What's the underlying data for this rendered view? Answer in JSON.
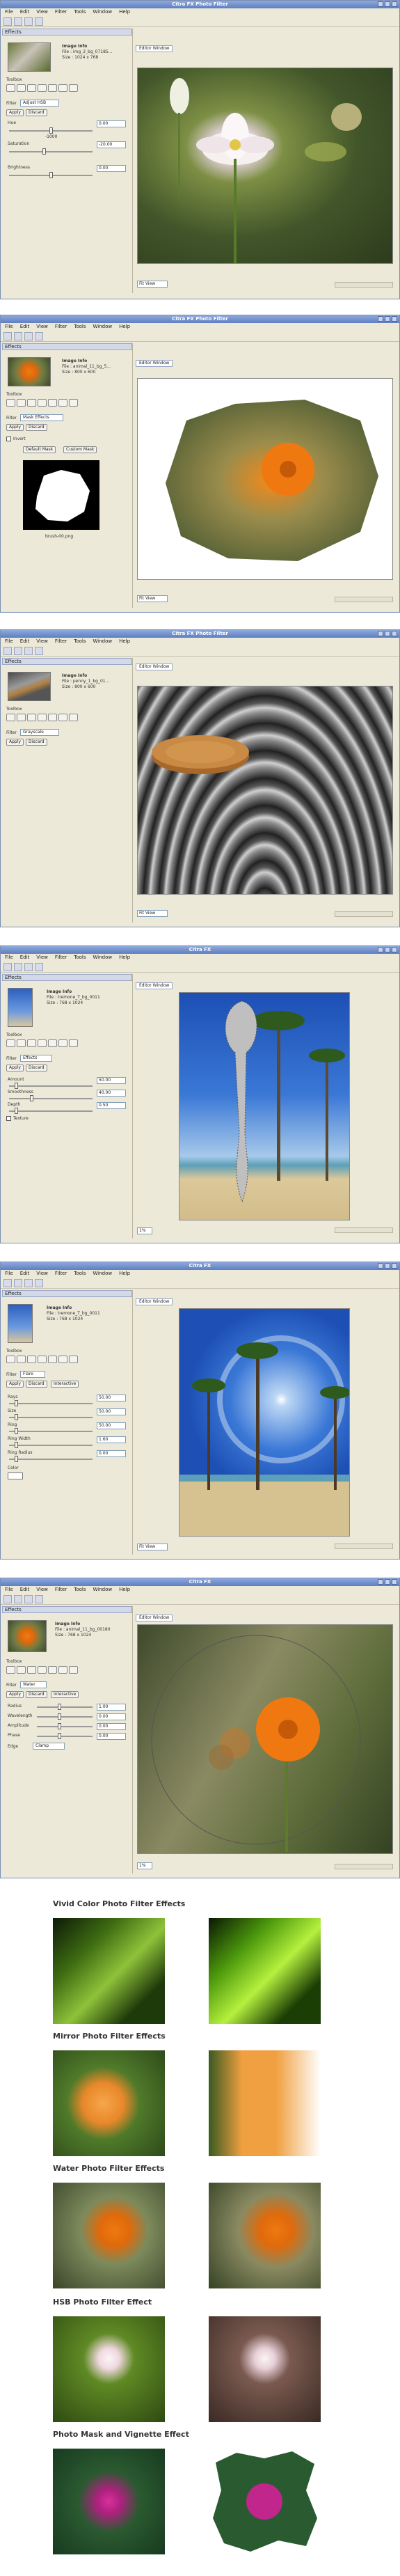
{
  "menu": [
    "File",
    "Edit",
    "View",
    "Filter",
    "Tools",
    "Window",
    "Help"
  ],
  "editor_window": "Editor Window",
  "image_info_title": "Image Info",
  "toolbox": "Toolbox",
  "windows": [
    {
      "title": "Citra FX Photo Filter",
      "panel": "Effects",
      "file": "File : img_2_bg_07185...",
      "size": "Size : 1024 x 768",
      "filter": "Adjust HSB",
      "buttons": [
        "Apply",
        "Discard"
      ],
      "fields": [
        {
          "label": "Hue",
          "value": "0.00"
        },
        {
          "label": "Saturation",
          "value": "-20.00"
        },
        {
          "label": "Brightness",
          "value": "0.00"
        }
      ],
      "mid_text": "-1000",
      "zoom": "Fit View"
    },
    {
      "title": "Citra FX Photo Filter",
      "panel": "Effects",
      "file": "File : animal_11_bg_5...",
      "size": "Size : 800 x 600",
      "filter": "Mask Effects",
      "buttons": [
        "Apply",
        "Discard"
      ],
      "invert": "Invert",
      "mask_buttons": [
        "Default Mask",
        "Custom Mask"
      ],
      "mask_name": "brush-00.png",
      "zoom": "Fit View"
    },
    {
      "title": "Citra FX Photo Filter",
      "panel": "Effects",
      "file": "File : penny_1_bg_01...",
      "size": "Size : 800 x 600",
      "filter": "Grayscale",
      "buttons": [
        "Apply",
        "Discard"
      ],
      "zoom": "Fit View"
    },
    {
      "title": "Citra FX",
      "panel": "Effects",
      "file": "File : tremone_T_bg_0011",
      "size": "Size : 768 x 1024",
      "filter": "Effects",
      "buttons": [
        "Apply",
        "Discard"
      ],
      "fields": [
        {
          "label": "Amount",
          "value": "50.00"
        },
        {
          "label": "Smoothness",
          "value": "40.00"
        },
        {
          "label": "Depth",
          "value": "0.50"
        }
      ],
      "texture": "Texture",
      "zoom": "1%"
    },
    {
      "title": "Citra FX",
      "panel": "Effects",
      "file": "File : tremone_T_bg_0011",
      "size": "Size : 768 x 1024",
      "filter": "Flare",
      "buttons": [
        "Apply",
        "Discard",
        "Interactive"
      ],
      "fields": [
        {
          "label": "Rays",
          "value": "50.00"
        },
        {
          "label": "Size",
          "value": "50.00"
        },
        {
          "label": "Ring",
          "value": "50.00"
        },
        {
          "label": "Ring Width",
          "value": "1.60"
        },
        {
          "label": "Ring Radius",
          "value": "0.00"
        }
      ],
      "color_label": "Color",
      "zoom": "Fit View"
    },
    {
      "title": "Citra FX",
      "panel": "Effects",
      "file": "File : animal_11_bg_00180",
      "size": "Size : 768 x 1024",
      "filter": "Water",
      "buttons": [
        "Apply",
        "Discard",
        "Interactive"
      ],
      "fields": [
        {
          "label": "Radius",
          "value": "1.00"
        },
        {
          "label": "Wavelength",
          "value": "0.00"
        },
        {
          "label": "Amplitude",
          "value": "0.00"
        },
        {
          "label": "Phase",
          "value": "0.00"
        }
      ],
      "edge_label": "Edge",
      "edge_value": "Clamp",
      "zoom": "1%"
    }
  ],
  "showcase": [
    {
      "heading": "Vivid Color Photo Filter Effects"
    },
    {
      "heading": "Mirror Photo Filter Effects"
    },
    {
      "heading": "Water Photo Filter Effects"
    },
    {
      "heading": "HSB Photo Filter Effect"
    },
    {
      "heading": "Photo Mask and Vignette Effect"
    }
  ]
}
